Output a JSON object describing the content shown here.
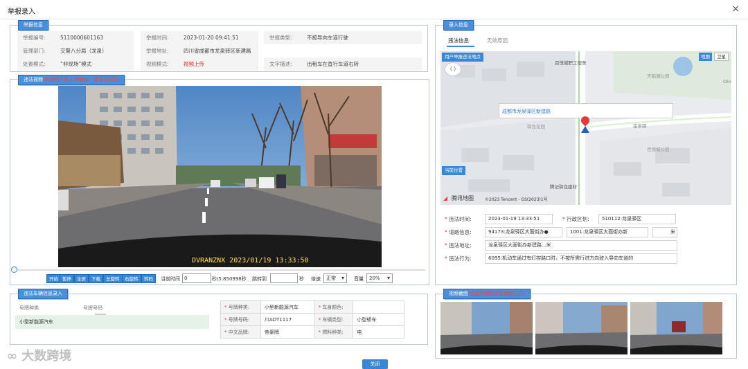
{
  "title": "举报录入",
  "close_glyph": "×",
  "report": {
    "tag": "举报信息",
    "fields": [
      {
        "label": "举报编号:",
        "value": "5110000601163"
      },
      {
        "label": "举报时间:",
        "value": "2023-01-20 09:41:51"
      },
      {
        "label": "举报类型:",
        "value": "不按导向车道行驶"
      },
      {
        "label": "管理部门:",
        "value": "交警八分局（龙泉）"
      },
      {
        "label": "举报地址:",
        "value": "四川省成都市龙泉驿区新建路"
      },
      {
        "label": "文字描述:",
        "value": "出租车在直行车道右转"
      },
      {
        "label": "处置模式:",
        "value": "“非现场”模式"
      },
      {
        "label": "视频模式:",
        "value": "视频上传"
      }
    ]
  },
  "video_section": {
    "tag": "违法视频",
    "tag_note": "(若视频不能正常播放，请尝试转码)",
    "overlay_text": "DVRANZNX   2023/01/19 13:33:50",
    "controls": [
      "开始",
      "暂停",
      "全屏",
      "下载",
      "左旋转",
      "右旋转",
      "转码"
    ],
    "current_time_label": "当前时间",
    "current_time": "0",
    "duration": "秒/5.850998秒",
    "jump_label": "跳转到",
    "jump_unit": "秒",
    "speed_label": "倍速",
    "speed_value": "正常",
    "volume_label": "音量",
    "volume_value": "20%"
  },
  "entry": {
    "tag": "录入信息",
    "tabs": [
      "违法信息",
      "无效原因"
    ],
    "map": {
      "poi_label": "用户举报违法地点",
      "location_label": "成都市龙泉驿区新建路",
      "current_pos": "当前位置",
      "map_btn": "地图",
      "sat_btn": "卫星",
      "provider": "腾讯地图",
      "copyright": "©2023 Tencent - GS(2023)1号",
      "places": [
        "百悦城职工宿舍",
        "天鹅湖公园",
        "驿龙花园",
        "金泉路",
        "百悦城公园",
        "腾记驿龙建材",
        "Ohm"
      ]
    },
    "fields": {
      "time_label": "违法时间:",
      "time": "2023-01-19 13:33:51",
      "district_label": "行政区划:",
      "district": "510112:龙泉驿区",
      "road_label": "道路信息:",
      "road1": "94173:龙泉驿区大面街办●",
      "road2": "1001:龙泉驿区大面街办新",
      "road_unit": "米",
      "addr_label": "违法地址:",
      "addr": "龙泉驿区大面街办新建路...米",
      "act_label": "违法行为:",
      "act": "6095:机动车通过有灯控路口时，不按所需行进方向驶入导向车道的"
    }
  },
  "vehicle": {
    "tag": "违法车辆信息录入",
    "col1": "号牌种类",
    "col2": "号牌号码",
    "row_value": "小型新能源汽车",
    "table": [
      [
        "号牌种类:",
        "小型新能源汽车",
        "车身颜色:",
        ""
      ],
      [
        "号牌号码:",
        "川ADT1117",
        "车辆类型:",
        "小型轿车"
      ],
      [
        "中文品牌:",
        "帝豪牌",
        "燃料种类:",
        "电"
      ]
    ]
  },
  "screenshots": {
    "tag": "视频截图",
    "tag_note": "(请旋转截图保证截图正向)"
  },
  "watermark": "大数跨境",
  "close_button": "关闭"
}
